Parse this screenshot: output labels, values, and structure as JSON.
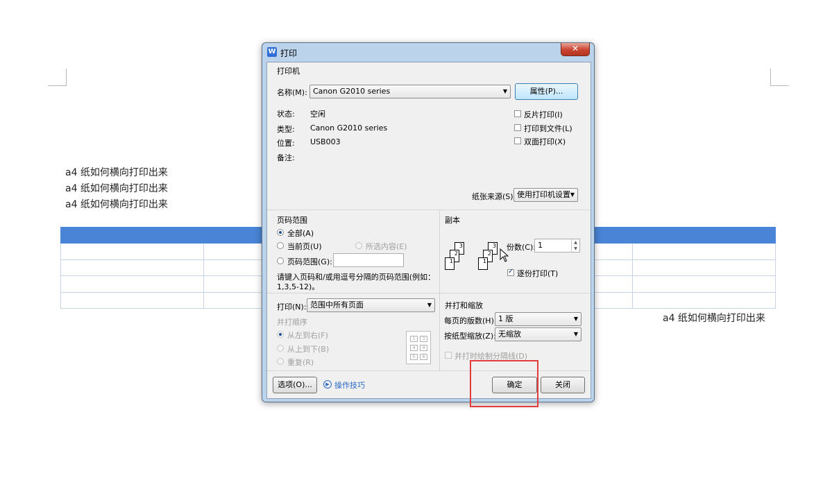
{
  "document": {
    "lines": [
      "a4 纸如何横向打印出来",
      "a4 纸如何横向打印出来",
      "a4 纸如何横向打印出来"
    ],
    "right_line": "a4 纸如何横向打印出来",
    "table_header_color": "#4a84d6"
  },
  "dialog": {
    "title": "打印",
    "app_icon_letter": "W",
    "close_glyph": "✕",
    "printer": {
      "section": "打印机",
      "name_label": "名称(M):",
      "name_value": "Canon G2010 series",
      "properties_button": "属性(P)...",
      "status_label": "状态:",
      "status_value": "空闲",
      "type_label": "类型:",
      "type_value": "Canon G2010 series",
      "location_label": "位置:",
      "location_value": "USB003",
      "comment_label": "备注:",
      "reverse_print": "反片打印(I)",
      "print_to_file": "打印到文件(L)",
      "duplex": "双面打印(X)",
      "paper_source_label": "纸张来源(S):",
      "paper_source_value": "使用打印机设置"
    },
    "page_range": {
      "section": "页码范围",
      "all": "全部(A)",
      "current": "当前页(U)",
      "selection": "所选内容(E)",
      "pages": "页码范围(G):",
      "pages_value": "",
      "hint": "请键入页码和/或用逗号分隔的页码范围(例如：",
      "hint2": "1,3,5-12)。"
    },
    "copies": {
      "section": "副本",
      "count_label": "份数(C):",
      "count_value": "1",
      "collate": "逐份打印(T)"
    },
    "print_what": {
      "label": "打印(N):",
      "value": "范围中所有页面"
    },
    "order": {
      "section": "并打顺序",
      "ltr": "从左到右(F)",
      "ttb": "从上到下(B)",
      "repeat": "重复(R)",
      "cells": [
        "1",
        "2",
        "3",
        "4",
        "5",
        "6"
      ]
    },
    "zoom": {
      "section": "并打和缩放",
      "pages_per_sheet_label": "每页的版数(H):",
      "pages_per_sheet_value": "1 版",
      "scale_label": "按纸型缩放(Z):",
      "scale_value": "无缩放",
      "draw_borders": "并打时绘制分隔线(D)"
    },
    "options_button": "选项(O)...",
    "tips_link": "操作技巧",
    "ok_button": "确定",
    "close_button": "关闭"
  },
  "colors": {
    "highlight": "#e23b3b",
    "link": "#2a68c8"
  }
}
